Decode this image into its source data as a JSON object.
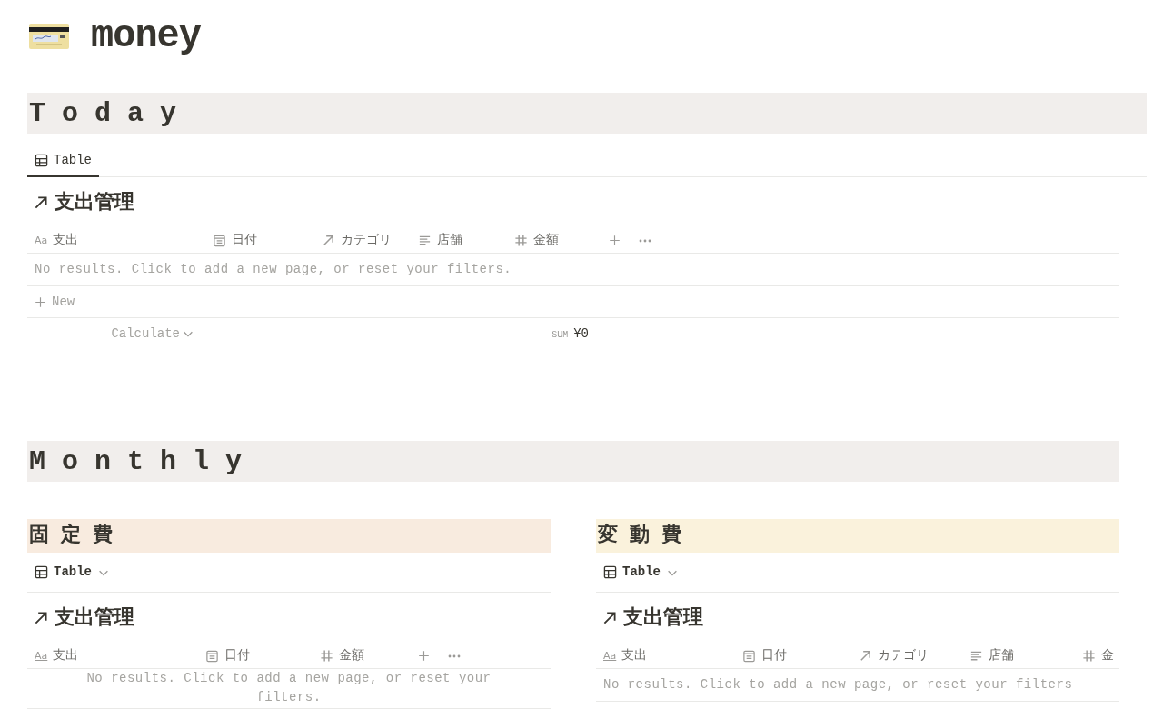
{
  "page": {
    "title": "money"
  },
  "today": {
    "heading": "T o d a y",
    "tabs": [
      {
        "label": "Table",
        "selected": true
      }
    ],
    "database": {
      "title": "支出管理",
      "columns": [
        {
          "label": "支出",
          "kind": "title",
          "icon_text": "Aa"
        },
        {
          "label": "日付",
          "kind": "date"
        },
        {
          "label": "カテゴリ",
          "kind": "relation"
        },
        {
          "label": "店舗",
          "kind": "text"
        },
        {
          "label": "金額",
          "kind": "number"
        }
      ],
      "empty_message": "No results. Click to add a new page, or reset your filters.",
      "new_label": "New",
      "calculate_label": "Calculate",
      "sum_label": "SUM",
      "sum_value": "¥0"
    }
  },
  "monthly": {
    "heading": "M o n t h l y",
    "panels": [
      {
        "heading": "固 定 費",
        "color": "#f8ebdf",
        "view": "Table",
        "database": {
          "title": "支出管理",
          "columns": [
            {
              "label": "支出",
              "kind": "title",
              "icon_text": "Aa"
            },
            {
              "label": "日付",
              "kind": "date"
            },
            {
              "label": "金額",
              "kind": "number"
            }
          ],
          "empty_message": "No results. Click to add a new page, or reset your filters."
        }
      },
      {
        "heading": "変 動 費",
        "color": "#faf2dc",
        "view": "Table",
        "database": {
          "title": "支出管理",
          "columns": [
            {
              "label": "支出",
              "kind": "title",
              "icon_text": "Aa"
            },
            {
              "label": "日付",
              "kind": "date"
            },
            {
              "label": "カテゴリ",
              "kind": "relation"
            },
            {
              "label": "店舗",
              "kind": "text"
            },
            {
              "label": "金",
              "kind": "number"
            }
          ],
          "empty_message": "No results. Click to add a new page, or reset your filters"
        }
      }
    ]
  }
}
